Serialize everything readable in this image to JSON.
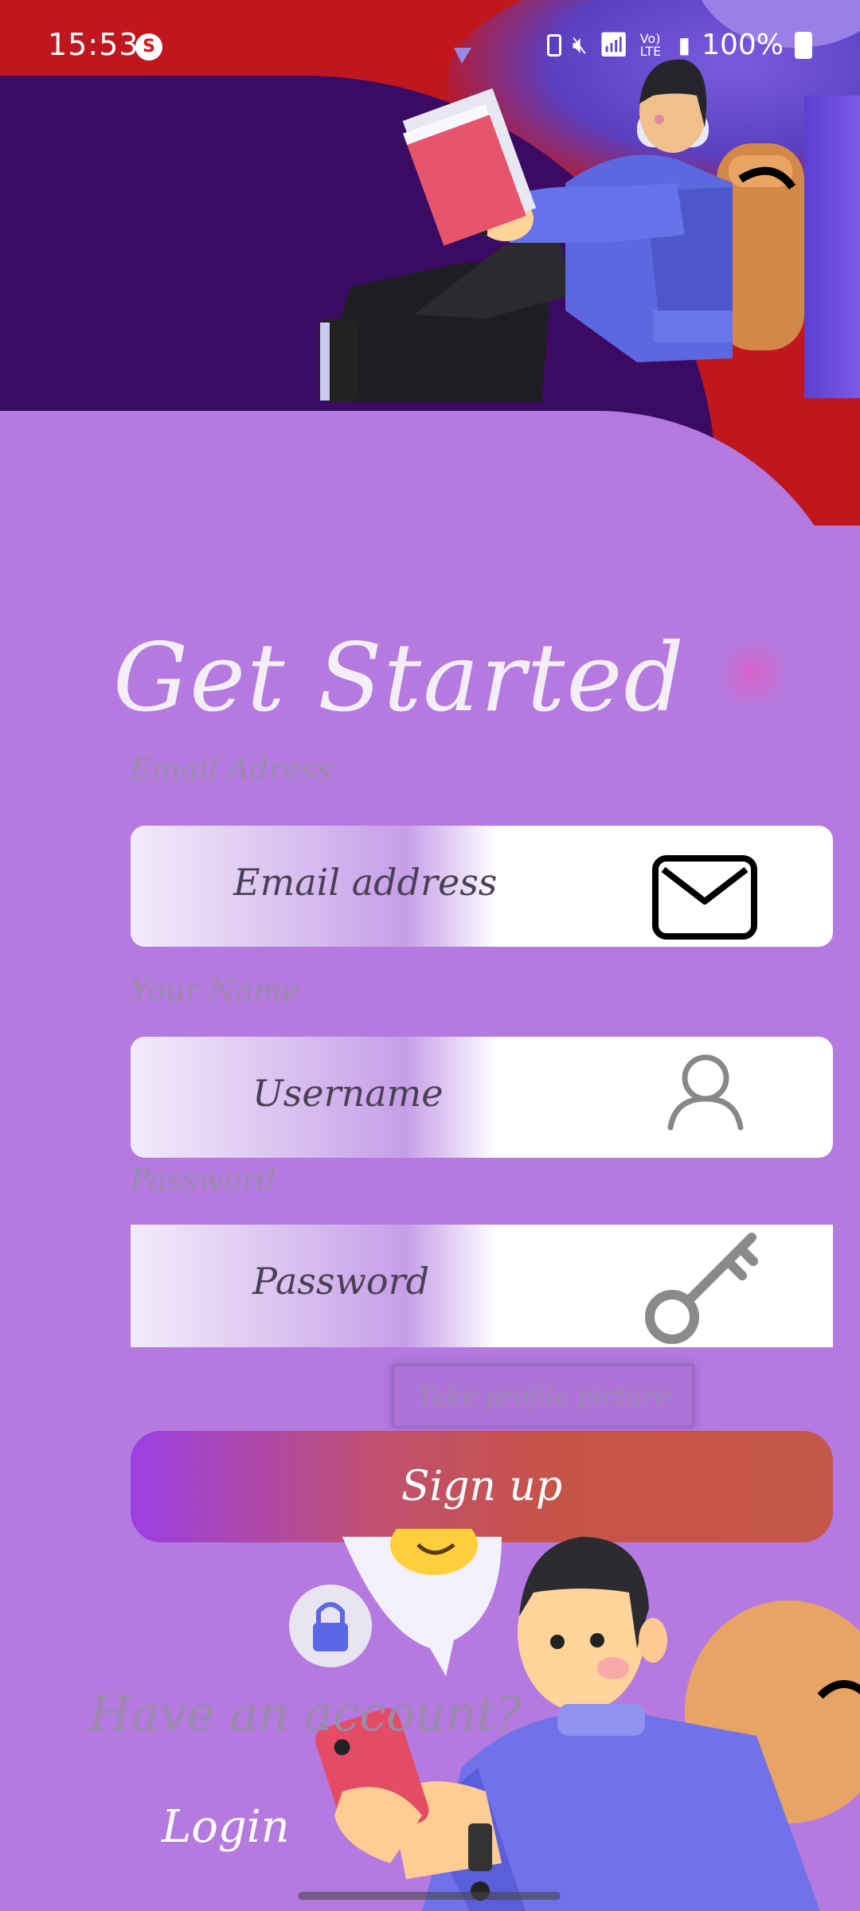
{
  "status_bar": {
    "time": "15:53",
    "app_icon_letter": "S",
    "network": "Vo) LTE",
    "battery": "100%"
  },
  "form": {
    "title": "Get Started",
    "email_label": "Email Adress",
    "email_placeholder": "Email address",
    "name_label": "Your Name",
    "name_placeholder": "Username",
    "password_label": "Password",
    "password_placeholder": "Password",
    "profile_picture_button": "Take profile picture",
    "signup_button": "Sign up",
    "have_account_text": "Have an account?",
    "login_link": "Login"
  },
  "icons": {
    "email": "envelope-icon",
    "user": "user-icon",
    "password": "key-icon",
    "lock": "lock-icon"
  },
  "colors": {
    "background": "#b57ae0",
    "header_red": "#c0161e",
    "header_dark": "#3b0a63",
    "title": "#f3eef7",
    "label": "#9a8aab",
    "signup_start": "#9b3fe4",
    "signup_end": "#c5574a"
  }
}
